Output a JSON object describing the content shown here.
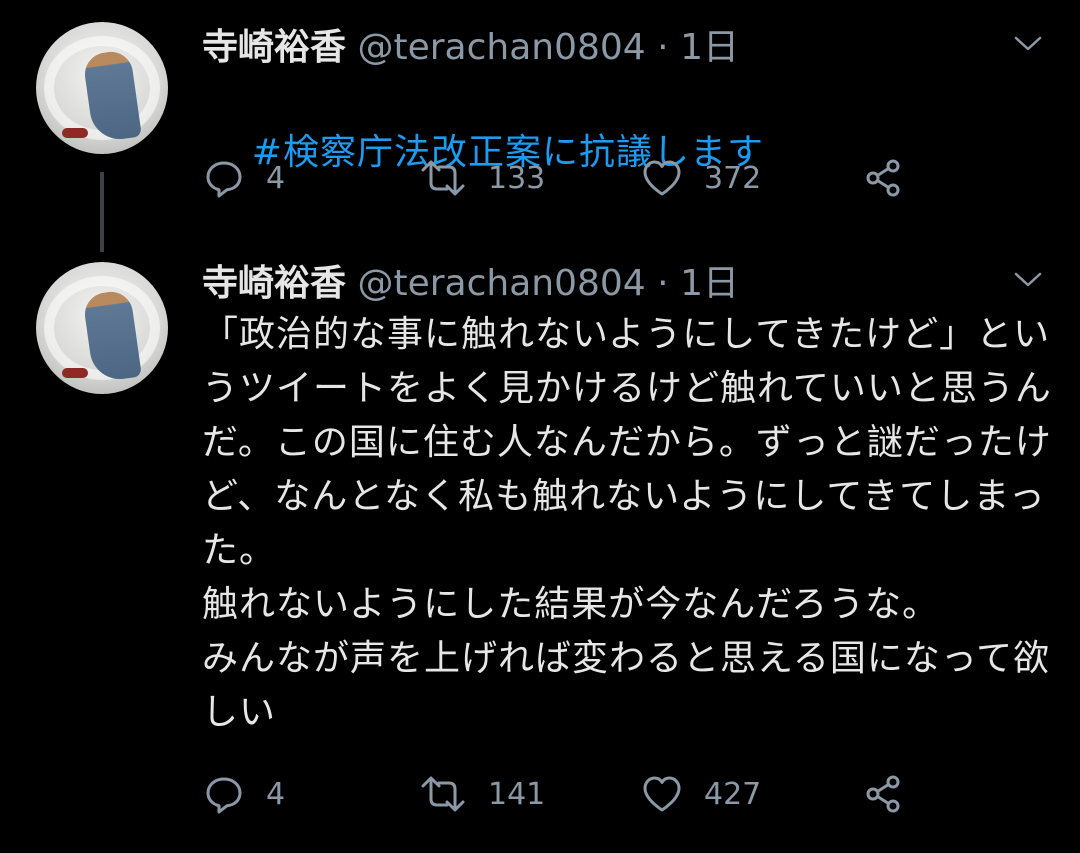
{
  "tweets": [
    {
      "display_name": "寺崎裕香",
      "handle": "@terachan0804",
      "separator": "·",
      "time": "1日",
      "text": "#検察庁法改正案に抗議します",
      "actions": {
        "reply": "4",
        "retweet": "133",
        "like": "372"
      }
    },
    {
      "display_name": "寺崎裕香",
      "handle": "@terachan0804",
      "separator": "·",
      "time": "1日",
      "text": "「政治的な事に触れないようにしてきたけど」というツイートをよく見かけるけど触れていいと思うんだ。この国に住む人なんだから。ずっと謎だったけど、なんとなく私も触れないようにしてきてしまった。\n触れないようにした結果が今なんだろうな。\nみんなが声を上げれば変わると思える国になって欲しい",
      "actions": {
        "reply": "4",
        "retweet": "141",
        "like": "427"
      }
    }
  ],
  "icons": [
    "caret-down-icon",
    "reply-icon",
    "retweet-icon",
    "like-icon",
    "share-icon"
  ],
  "colors": {
    "background": "#000000",
    "text": "#e6e6e6",
    "secondary": "#8b98a5",
    "hashtag": "#1d9bf0",
    "thread_line": "#3d4248"
  }
}
